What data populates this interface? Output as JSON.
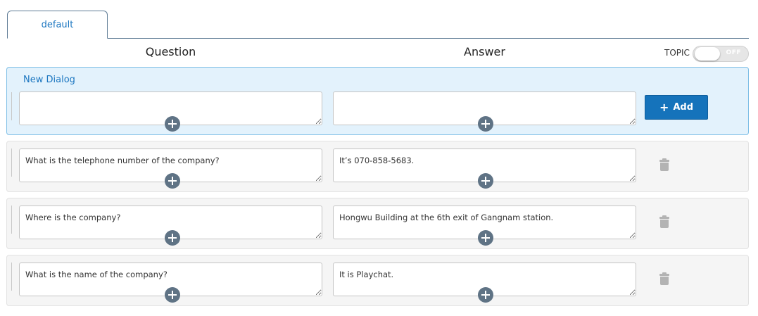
{
  "tabs": [
    {
      "label": "default",
      "active": true
    }
  ],
  "columns": {
    "question": "Question",
    "answer": "Answer"
  },
  "topic": {
    "label": "TOPIC",
    "toggle_state": "OFF"
  },
  "new_dialog": {
    "title": "New Dialog",
    "question_value": "",
    "answer_value": "",
    "add_button_label": "+ Add",
    "add_button_text": "Add"
  },
  "dialogs": [
    {
      "question": "What is the telephone number of the company?",
      "answer": "It’s 070-858-5683."
    },
    {
      "question": "Where is the company?",
      "answer": "Hongwu Building at the 6th exit of Gangnam station."
    },
    {
      "question": "What is the name of the company?",
      "answer": "It is Playchat."
    }
  ],
  "colors": {
    "accent": "#1573bb",
    "link": "#1b76c0",
    "new_panel_bg": "#e3f2fc",
    "new_panel_border": "#7fbfe6",
    "row_bg": "#f5f5f5",
    "plus_icon": "#5f7385",
    "trash_icon": "#b3b3b3"
  },
  "icons": {
    "add": "plus-icon",
    "expand": "plus-circle-icon",
    "delete": "trash-icon"
  }
}
